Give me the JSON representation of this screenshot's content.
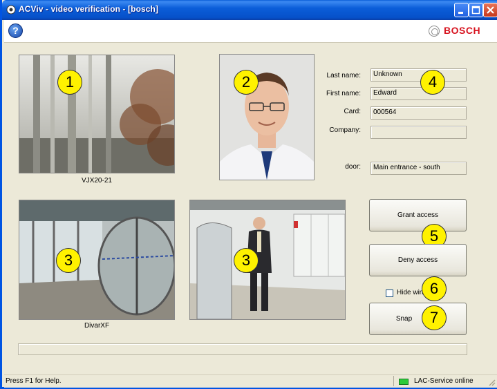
{
  "window": {
    "title": "ACViv - video verification - [bosch]",
    "controls": [
      "minimize",
      "maximize",
      "close"
    ]
  },
  "header": {
    "help_icon": "help-icon",
    "brand": "BOSCH"
  },
  "cameras": [
    {
      "caption": "VJX20-21",
      "badge": "1"
    },
    {
      "caption": "",
      "badge": "2"
    },
    {
      "caption": "DivarXF",
      "badge": "3"
    },
    {
      "caption": "",
      "badge": "3"
    }
  ],
  "person": {
    "last_name_label": "Last name:",
    "last_name": "Unknown",
    "first_name_label": "First name:",
    "first_name": "Edward",
    "card_label": "Card:",
    "card": "000564",
    "company_label": "Company:",
    "company": "",
    "door_label": "door:",
    "door": "Main entrance - south",
    "badge": "4"
  },
  "actions": {
    "grant_label": "Grant access",
    "grant_badge": "5",
    "deny_label": "Deny access",
    "hide_label": "Hide wind",
    "hide_checked": false,
    "hide_badge": "6",
    "snap_label": "Snap",
    "snap_badge": "7"
  },
  "statusbar": {
    "help_text": "Press F1 for Help.",
    "service_text": "LAC-Service online",
    "service_color": "#2CCB3A"
  }
}
